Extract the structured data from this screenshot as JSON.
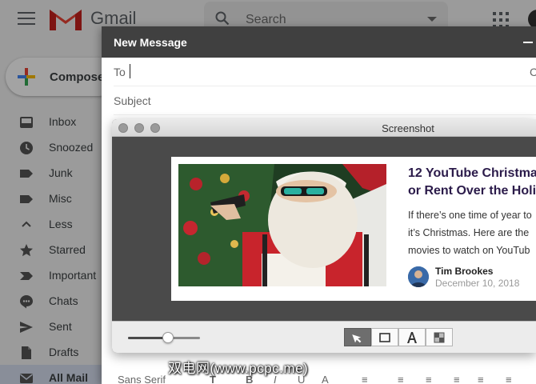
{
  "gmail": {
    "logo_text": "Gmail",
    "search_placeholder": "Search",
    "compose_label": "Compose",
    "nav": [
      {
        "label": "Inbox",
        "icon": "inbox-icon"
      },
      {
        "label": "Snoozed",
        "icon": "clock-icon"
      },
      {
        "label": "Junk",
        "icon": "label-icon"
      },
      {
        "label": "Misc",
        "icon": "label-icon"
      },
      {
        "label": "Less",
        "icon": "chevron-up-icon"
      },
      {
        "label": "Starred",
        "icon": "star-icon"
      },
      {
        "label": "Important",
        "icon": "important-icon"
      },
      {
        "label": "Chats",
        "icon": "chat-icon"
      },
      {
        "label": "Sent",
        "icon": "send-icon"
      },
      {
        "label": "Drafts",
        "icon": "draft-icon"
      },
      {
        "label": "All Mail",
        "icon": "mail-icon"
      }
    ],
    "active_nav": "All Mail"
  },
  "new_message": {
    "title": "New Message",
    "to_label": "To",
    "cc_label": "C",
    "subject_placeholder": "Subject",
    "font_select": "Sans Serif"
  },
  "screenshot_window": {
    "title": "Screenshot",
    "zoom_level": 0.55,
    "tools": [
      "pointer-tool-icon",
      "rectangle-tool-icon",
      "text-tool-icon",
      "mask-tool-icon"
    ],
    "selected_tool": 0
  },
  "article": {
    "title_line1": "12 YouTube Christmas",
    "title_line2": "or Rent Over the Holi",
    "excerpt_line1": "If there’s one time of year to",
    "excerpt_line2": "it’s Christmas. Here are the",
    "excerpt_line3": "movies to watch on YouTub",
    "author": "Tim Brookes",
    "date": "December 10, 2018"
  },
  "watermark": "双电网(www.pcpc.me)",
  "colors": {
    "gmail_red": "#EA4335",
    "compose_title_bar": "#404040",
    "article_title": "#2B1B4A",
    "active_nav_bg": "#D7DFF0"
  }
}
